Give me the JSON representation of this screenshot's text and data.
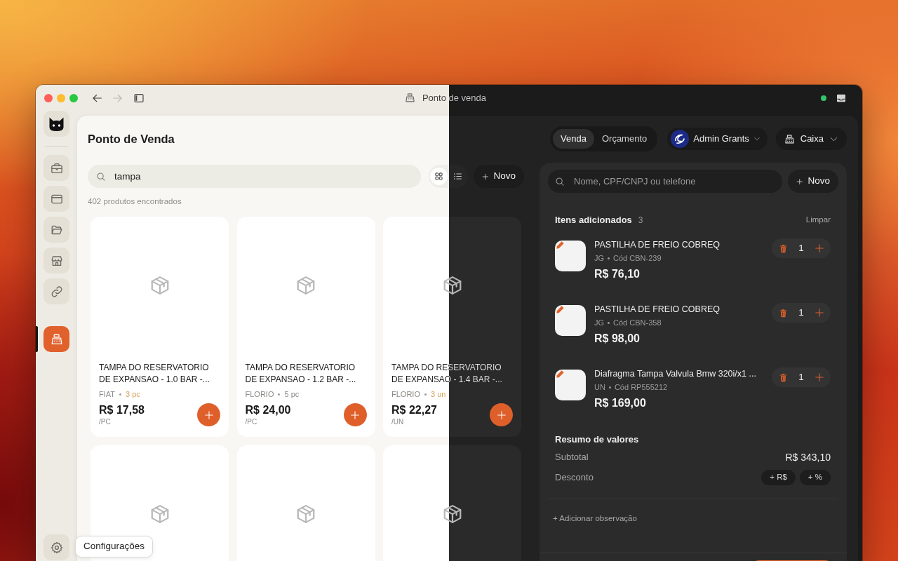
{
  "window": {
    "title": "Ponto de venda",
    "nav": [
      {
        "disabled": false
      },
      {
        "disabled": true
      }
    ]
  },
  "sidebar": {
    "groups": [
      {
        "items": [
          {
            "selected": false
          },
          {
            "selected": false
          },
          {
            "selected": false
          },
          {
            "selected": false
          },
          {
            "selected": false
          }
        ]
      },
      {
        "items": [
          {
            "selected": true
          }
        ]
      }
    ],
    "settings_tooltip": "Configurações"
  },
  "header": {
    "title": "Ponto de Venda",
    "modes": [
      {
        "label": "Venda",
        "selected": true
      },
      {
        "label": "Orçamento",
        "selected": false
      }
    ],
    "user": {
      "name": "Admin Grants"
    },
    "register": {
      "label": "Caixa"
    }
  },
  "catalog": {
    "search": {
      "value": "tampa"
    },
    "views": [
      {
        "selected": true
      },
      {
        "selected": false
      }
    ],
    "new_button": "Novo",
    "result_count": "402 produtos encontrados",
    "products": [
      {
        "has_image": false,
        "name": "TAMPA DO RESERVATORIO DE EXPANSAO - 1.0 BAR -...",
        "brand": "FIAT",
        "stock": "3 pc",
        "low_stock": true,
        "price": "R$ 17,58",
        "unit": "/PC"
      },
      {
        "has_image": false,
        "name": "TAMPA DO RESERVATORIO DE EXPANSAO - 1.2 BAR -...",
        "brand": "FLORIO",
        "stock": "5 pc",
        "low_stock": false,
        "price": "R$ 24,00",
        "unit": "/PC"
      },
      {
        "has_image": false,
        "name": "TAMPA DO RESERVATORIO DE EXPANSAO - 1.4 BAR -...",
        "brand": "FLORIO",
        "stock": "3 un",
        "low_stock": true,
        "price": "R$ 22,27",
        "unit": "/UN"
      },
      {
        "has_image": false
      },
      {
        "has_image": false
      },
      {
        "has_image": false
      }
    ]
  },
  "cart": {
    "customer_search": {
      "placeholder": "Nome, CPF/CNPJ ou telefone"
    },
    "new_button": "Novo",
    "title": "Itens adicionados",
    "count": "3",
    "clear_button": "Limpar",
    "items": [
      {
        "name": "PASTILHA DE FREIO COBREQ",
        "unit": "JG",
        "code": "Cód CBN-239",
        "price": "R$ 76,10",
        "quantity": "1"
      },
      {
        "name": "PASTILHA DE FREIO COBREQ",
        "unit": "JG",
        "code": "Cód CBN-358",
        "price": "R$ 98,00",
        "quantity": "1"
      },
      {
        "name": "Diafragma Tampa Valvula Bmw 320i/x1 ...",
        "unit": "UN",
        "code": "Cód RP555212",
        "price": "R$ 169,00",
        "quantity": "1"
      }
    ],
    "summary": {
      "title": "Resumo de valores",
      "subtotal_label": "Subtotal",
      "subtotal": "R$ 343,10",
      "discount_label": "Desconto",
      "discount_options": [
        "+ R$",
        "+ %"
      ]
    },
    "note_link": "+ Adicionar observação"
  }
}
